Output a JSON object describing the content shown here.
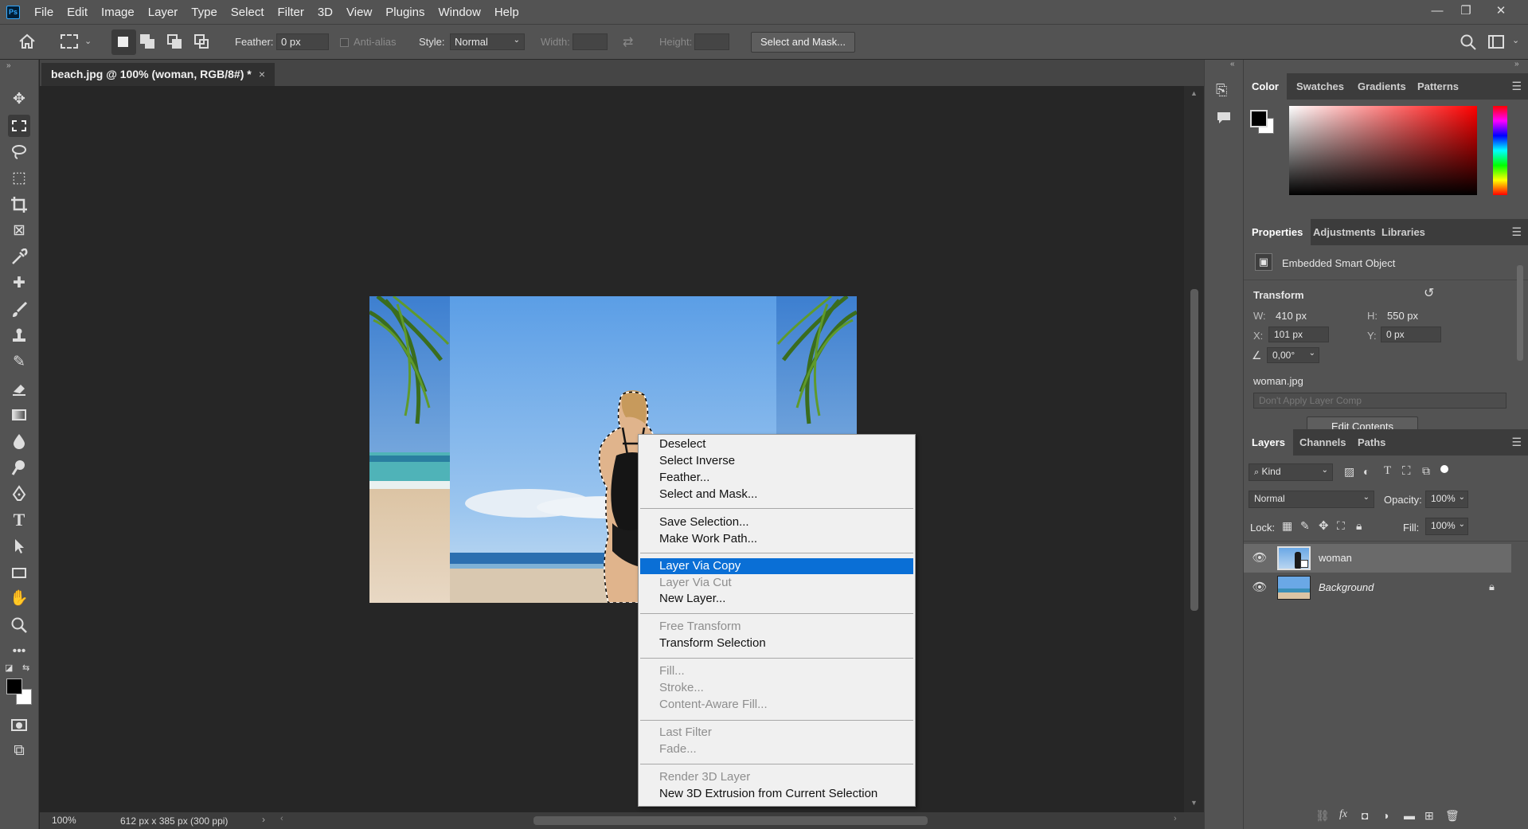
{
  "menubar": {
    "app_logo": "Ps",
    "items": [
      "File",
      "Edit",
      "Image",
      "Layer",
      "Type",
      "Select",
      "Filter",
      "3D",
      "View",
      "Plugins",
      "Window",
      "Help"
    ]
  },
  "options": {
    "feather_label": "Feather:",
    "feather_value": "0 px",
    "antialias_label": "Anti-alias",
    "style_label": "Style:",
    "style_value": "Normal",
    "width_label": "Width:",
    "height_label": "Height:",
    "select_mask_button": "Select and Mask..."
  },
  "document": {
    "tab_title": "beach.jpg @ 100% (woman, RGB/8#) *",
    "zoom": "100%",
    "doc_info": "612 px x 385 px (300 ppi)"
  },
  "context_menu": {
    "groups": [
      [
        {
          "label": "Deselect",
          "enabled": true
        },
        {
          "label": "Select Inverse",
          "enabled": true
        },
        {
          "label": "Feather...",
          "enabled": true
        },
        {
          "label": "Select and Mask...",
          "enabled": true
        }
      ],
      [
        {
          "label": "Save Selection...",
          "enabled": true
        },
        {
          "label": "Make Work Path...",
          "enabled": true
        }
      ],
      [
        {
          "label": "Layer Via Copy",
          "enabled": true,
          "highlighted": true
        },
        {
          "label": "Layer Via Cut",
          "enabled": false
        },
        {
          "label": "New Layer...",
          "enabled": true
        }
      ],
      [
        {
          "label": "Free Transform",
          "enabled": false
        },
        {
          "label": "Transform Selection",
          "enabled": true
        }
      ],
      [
        {
          "label": "Fill...",
          "enabled": false
        },
        {
          "label": "Stroke...",
          "enabled": false
        },
        {
          "label": "Content-Aware Fill...",
          "enabled": false
        }
      ],
      [
        {
          "label": "Last Filter",
          "enabled": false
        },
        {
          "label": "Fade...",
          "enabled": false
        }
      ],
      [
        {
          "label": "Render 3D Layer",
          "enabled": false
        },
        {
          "label": "New 3D Extrusion from Current Selection",
          "enabled": true
        }
      ]
    ]
  },
  "color_panel": {
    "tabs": [
      "Color",
      "Swatches",
      "Gradients",
      "Patterns"
    ],
    "foreground": "#000000",
    "background": "#ffffff",
    "hue_color": "#ff0000"
  },
  "properties_panel": {
    "tabs": [
      "Properties",
      "Adjustments",
      "Libraries"
    ],
    "object_type": "Embedded Smart Object",
    "transform_label": "Transform",
    "w_label": "W:",
    "w_value": "410 px",
    "h_label": "H:",
    "h_value": "550 px",
    "x_label": "X:",
    "x_value": "101 px",
    "y_label": "Y:",
    "y_value": "0 px",
    "angle_value": "0,00°",
    "filename": "woman.jpg",
    "layer_comp": "Don't Apply Layer Comp",
    "edit_button": "Edit Contents"
  },
  "layers_panel": {
    "tabs": [
      "Layers",
      "Channels",
      "Paths"
    ],
    "filter_kind": "Kind",
    "blend_mode": "Normal",
    "opacity_label": "Opacity:",
    "opacity_value": "100%",
    "lock_label": "Lock:",
    "fill_label": "Fill:",
    "fill_value": "100%",
    "layers": [
      {
        "name": "woman",
        "selected": true
      },
      {
        "name": "Background",
        "selected": false,
        "locked": true
      }
    ]
  }
}
